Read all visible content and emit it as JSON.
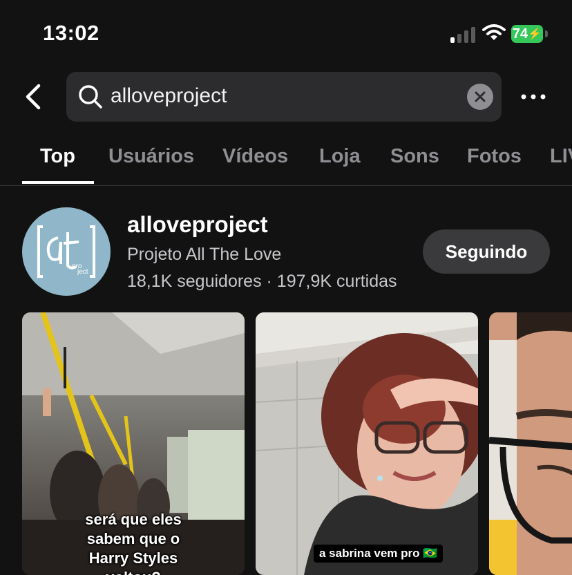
{
  "status": {
    "time": "13:02",
    "battery": "74"
  },
  "search": {
    "query": "alloveproject"
  },
  "tabs": [
    {
      "label": "Top",
      "active": true
    },
    {
      "label": "Usuários"
    },
    {
      "label": "Vídeos"
    },
    {
      "label": "Loja"
    },
    {
      "label": "Sons"
    },
    {
      "label": "Fotos"
    },
    {
      "label": "LIV"
    }
  ],
  "profile": {
    "username": "alloveproject",
    "full_name": "Projeto All The Love",
    "stats": "18,1K seguidores · 197,9K curtidas",
    "follow_label": "Seguindo",
    "avatar_logo": "at",
    "avatar_small": "pro ject"
  },
  "videos": [
    {
      "caption": "será que eles sabem que o Harry Styles voltou?"
    },
    {
      "caption": "a sabrina vem pro 🇧🇷"
    },
    {
      "caption": ""
    }
  ],
  "colors": {
    "accent": "#35c759",
    "background": "#121212",
    "avatar_bg": "#8fb7c9"
  }
}
